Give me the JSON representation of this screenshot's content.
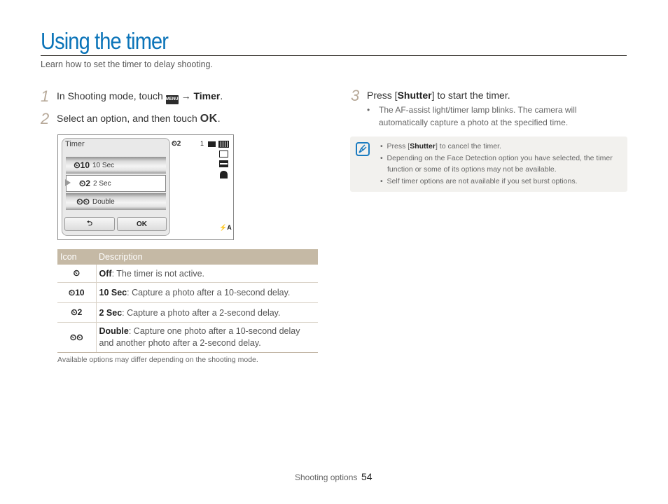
{
  "page": {
    "title": "Using the timer",
    "subtitle": "Learn how to set the timer to delay shooting."
  },
  "steps": [
    {
      "number": "1",
      "text_before": "In Shooting mode, touch",
      "menu_icon_label": "MENU",
      "arrow": "→",
      "bold": "Timer",
      "text_after": "."
    },
    {
      "number": "2",
      "text_before": "Select an option, and then touch",
      "ok_glyph": "OK",
      "text_after": "."
    },
    {
      "number": "3",
      "text_before": "Press [",
      "bold": "Shutter",
      "text_after": "] to start the timer.",
      "bullet": "The AF-assist light/timer lamp blinks. The camera will automatically capture a photo at the specified time."
    }
  ],
  "camera_screen": {
    "panel_title": "Timer",
    "options": [
      {
        "icon": "timer-10-icon",
        "icon_glyph": "⏲10",
        "label": "10 Sec",
        "selected": false
      },
      {
        "icon": "timer-2-icon",
        "icon_glyph": "⏲2",
        "label": "2 Sec",
        "selected": true
      },
      {
        "icon": "timer-double-icon",
        "icon_glyph": "⏲⏲",
        "label": "Double",
        "selected": false
      }
    ],
    "back_button_glyph": "⮌",
    "ok_button": "OK",
    "status": {
      "timer_indicator": "⏲2",
      "shot_count": "1",
      "flash_glyph": "⚡A"
    }
  },
  "table": {
    "headers": [
      "Icon",
      "Description"
    ],
    "rows": [
      {
        "icon": "timer-off-icon",
        "glyph": "⏲",
        "term": "Off",
        "desc": ": The timer is not active."
      },
      {
        "icon": "timer-10-icon",
        "glyph": "⏲10",
        "term": "10 Sec",
        "desc": ": Capture a photo after a 10-second delay."
      },
      {
        "icon": "timer-2-icon",
        "glyph": "⏲2",
        "term": "2 Sec",
        "desc": ": Capture a photo after a 2-second delay."
      },
      {
        "icon": "timer-double-icon",
        "glyph": "⏲⏲",
        "term": "Double",
        "desc": ": Capture one photo after a 10-second delay and another photo after a 2-second delay."
      }
    ],
    "note": "Available options may differ depending on the shooting mode."
  },
  "note_box": {
    "icon": "note-pencil-icon",
    "items": [
      {
        "before": "Press [",
        "bold": "Shutter",
        "after": "] to cancel the timer."
      },
      {
        "before": "Depending on the Face Detection option you have selected, the timer function or some of its options may not be available.",
        "bold": "",
        "after": ""
      },
      {
        "before": "Self timer options are not available if you set burst options.",
        "bold": "",
        "after": ""
      }
    ]
  },
  "footer": {
    "section": "Shooting options",
    "page_number": "54"
  },
  "colors": {
    "title_blue": "#0a73b8",
    "step_number": "#b7a999",
    "table_header": "#c5b9a5",
    "note_bg": "#f2f1ee"
  }
}
